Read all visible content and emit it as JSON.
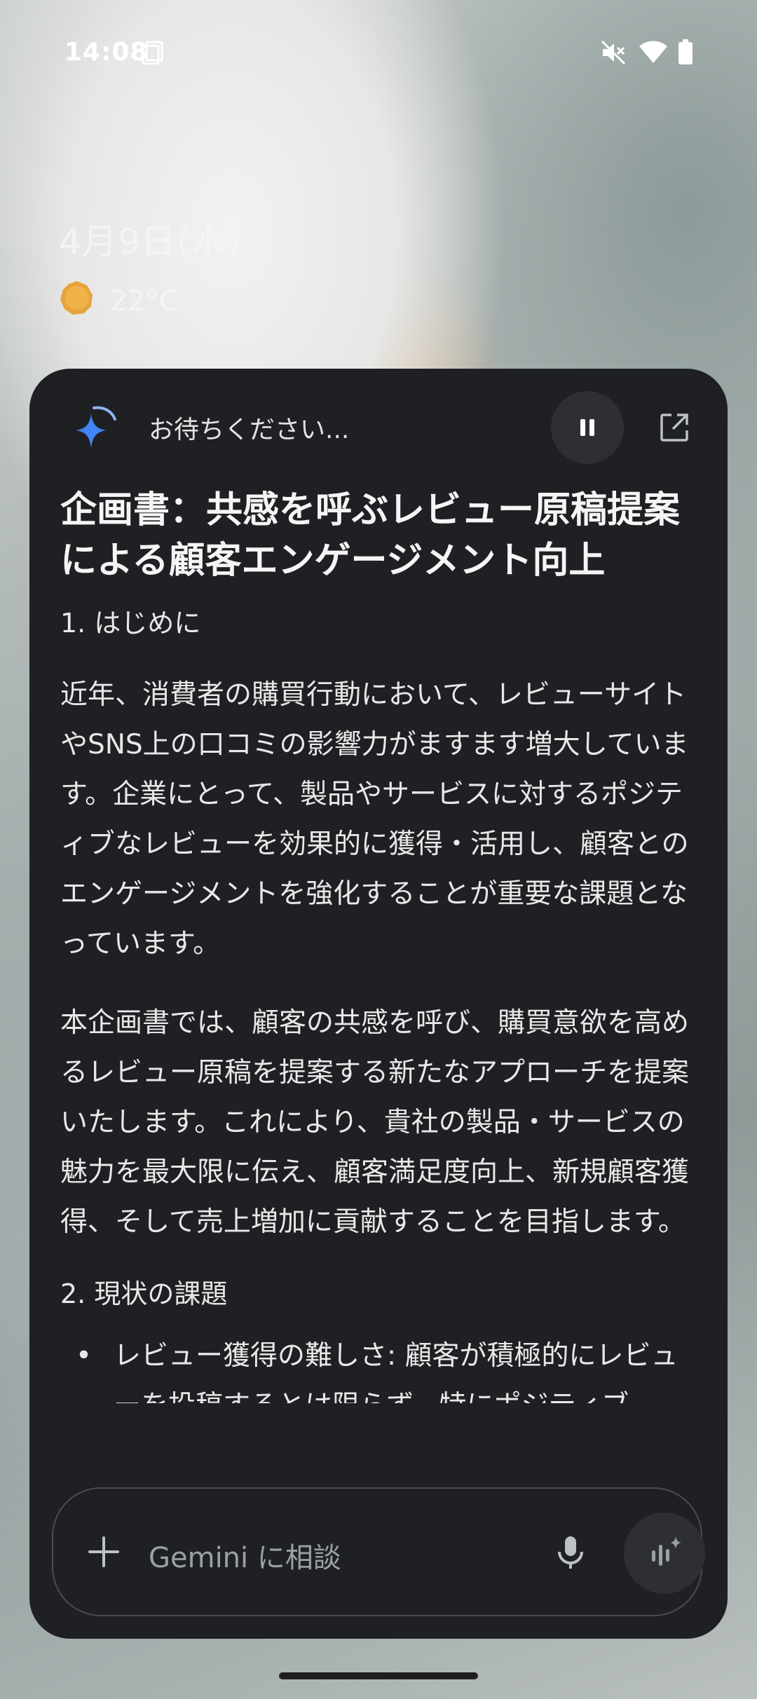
{
  "status_bar": {
    "time": "14:08",
    "icons": [
      "screenshot-icon",
      "mute-icon",
      "wifi-icon",
      "battery-icon"
    ]
  },
  "lock_screen": {
    "date": "4月9日(水)",
    "weather_temp": "22°C",
    "weather_icon": "sun-icon"
  },
  "assistant": {
    "status": "お待ちください...",
    "title": "企画書：共感を呼ぶレビュー原稿提案による顧客エンゲージメント向上",
    "section1_heading": "1. はじめに",
    "para1": "近年、消費者の購買行動において、レビューサイトやSNS上の口コミの影響力がますます増大しています。企業にとって、製品やサービスに対するポジティブなレビューを効果的に獲得・活用し、顧客とのエンゲージメントを強化することが重要な課題となっています。",
    "para2": "本企画書では、顧客の共感を呼び、購買意欲を高めるレビュー原稿を提案する新たなアプローチを提案いたします。これにより、貴社の製品・サービスの魅力を最大限に伝え、顧客満足度向上、新規顧客獲得、そして売上増加に貢献することを目指します。",
    "section2_heading": "2. 現状の課題",
    "bullet1": "レビュー獲得の難しさ: 顧客が積極的にレビューを投稿するとは限らず、特にポジティブ",
    "input_placeholder": "Gemini に相談"
  },
  "colors": {
    "panel_bg": "#1f2023",
    "gemini_blue": "#4285f4",
    "text_primary": "#e8e8e8"
  }
}
